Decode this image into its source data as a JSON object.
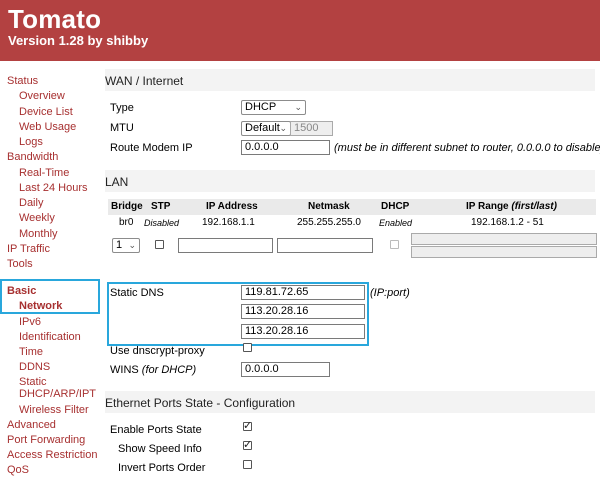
{
  "header": {
    "title": "Tomato",
    "version": "Version 1.28 by shibby"
  },
  "sidebar": {
    "items": [
      {
        "label": "Status",
        "level": 0
      },
      {
        "label": "Overview",
        "level": 1
      },
      {
        "label": "Device List",
        "level": 1
      },
      {
        "label": "Web Usage",
        "level": 1
      },
      {
        "label": "Logs",
        "level": 1
      },
      {
        "label": "Bandwidth",
        "level": 0
      },
      {
        "label": "Real-Time",
        "level": 1
      },
      {
        "label": "Last 24 Hours",
        "level": 1
      },
      {
        "label": "Daily",
        "level": 1
      },
      {
        "label": "Weekly",
        "level": 1
      },
      {
        "label": "Monthly",
        "level": 1
      },
      {
        "label": "IP Traffic",
        "level": 0
      },
      {
        "label": "Tools",
        "level": 0
      },
      {
        "label": "Basic",
        "level": 0
      },
      {
        "label": "Network",
        "level": 1
      },
      {
        "label": "IPv6",
        "level": 1
      },
      {
        "label": "Identification",
        "level": 1
      },
      {
        "label": "Time",
        "level": 1
      },
      {
        "label": "DDNS",
        "level": 1
      },
      {
        "label": "Static",
        "level": 1
      },
      {
        "label": "DHCP/ARP/IPT",
        "level": 1
      },
      {
        "label": "Wireless Filter",
        "level": 1
      },
      {
        "label": "Advanced",
        "level": 0
      },
      {
        "label": "Port Forwarding",
        "level": 0
      },
      {
        "label": "Access Restriction",
        "level": 0
      },
      {
        "label": "QoS",
        "level": 0
      }
    ]
  },
  "wan": {
    "title": "WAN / Internet",
    "type_label": "Type",
    "type_value": "DHCP",
    "mtu_label": "MTU",
    "mtu_select": "Default",
    "mtu_value": "1500",
    "route_label": "Route Modem IP",
    "route_value": "0.0.0.0",
    "route_note": "(must be in different subnet to router, 0.0.0.0 to disable)"
  },
  "lan": {
    "title": "LAN",
    "headers": {
      "bridge": "Bridge",
      "stp": "STP",
      "ip": "IP Address",
      "netmask": "Netmask",
      "dhcp": "DHCP",
      "range": "IP Range ",
      "range_suffix": "(first/last)"
    },
    "row": {
      "bridge": "br0",
      "stp": "Disabled",
      "ip": "192.168.1.1",
      "netmask": "255.255.255.0",
      "dhcp": "Enabled",
      "range": "192.168.1.2 - 51"
    },
    "new_bridge": "1"
  },
  "dns": {
    "label": "Static DNS",
    "servers": [
      "119.81.72.65",
      "113.20.28.16",
      "113.20.28.16"
    ],
    "note": "(IP:port)",
    "dnscrypt_label": "Use dnscrypt-proxy",
    "wins_label": "WINS ",
    "wins_suffix": "(for DHCP)",
    "wins_value": "0.0.0.0"
  },
  "ports": {
    "title": "Ethernet Ports State - Configuration",
    "enable_label": "Enable Ports State",
    "speed_label": "Show Speed Info",
    "invert_label": "Invert Ports Order"
  },
  "colors": {
    "header": "#b34141",
    "link": "#a73030",
    "highlight": "#29a7dc"
  }
}
